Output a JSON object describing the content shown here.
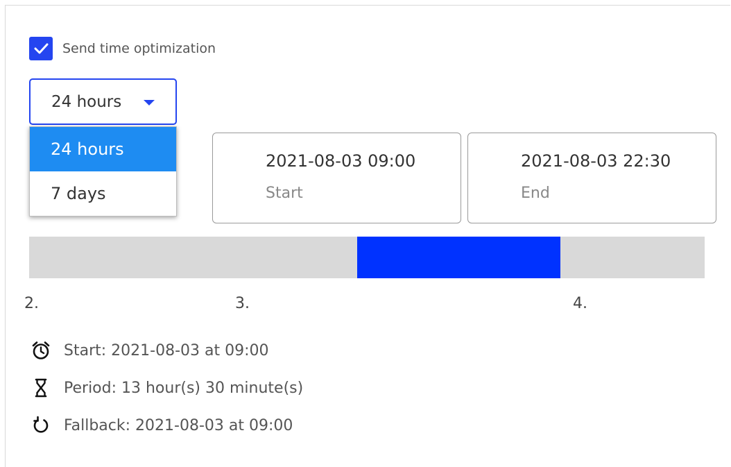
{
  "optimization": {
    "checkbox_checked": true,
    "checkbox_label": "Send time optimization"
  },
  "period_select": {
    "value": "24 hours",
    "options": [
      "24 hours",
      "7 days"
    ],
    "selected_index": 0
  },
  "start_field": {
    "value": "2021-08-03 09:00",
    "label": "Start"
  },
  "end_field": {
    "value": "2021-08-03 22:30",
    "label": "End"
  },
  "timeline": {
    "ticks": [
      "2.",
      "3.",
      "4."
    ],
    "active_start_fraction": 0.486,
    "active_end_fraction": 0.786,
    "colors": {
      "track": "#d9d9d9",
      "active": "#0032ff"
    }
  },
  "summary": {
    "start_text": "Start: 2021-08-03 at 09:00",
    "period_text": "Period: 13 hour(s) 30 minute(s)",
    "fallback_text": "Fallback: 2021-08-03 at 09:00",
    "icons": [
      "alarm-clock-icon",
      "hourglass-icon",
      "refresh-icon"
    ]
  },
  "colors": {
    "accent": "#2445f0",
    "selected_option": "#1e8cf2"
  }
}
